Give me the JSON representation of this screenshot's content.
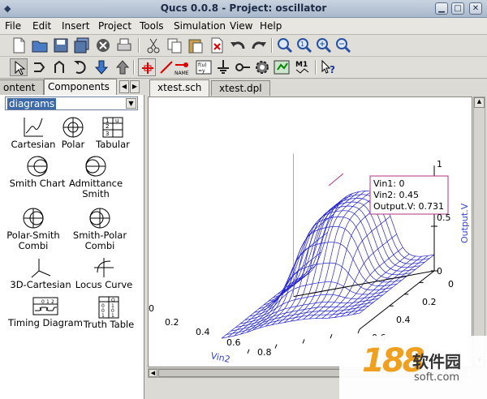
{
  "window": {
    "title": "Qucs 0.0.8 - Project: oscillator"
  },
  "menu": [
    "File",
    "Edit",
    "Insert",
    "Project",
    "Tools",
    "Simulation",
    "View",
    "Help"
  ],
  "left_panel": {
    "tabs": [
      "ontent",
      "Components"
    ],
    "category": "diagrams",
    "components": [
      {
        "label": "Cartesian",
        "icon": "cartesian-icon"
      },
      {
        "label": "Polar",
        "icon": "polar-icon"
      },
      {
        "label": "Tabular",
        "icon": "tabular-icon"
      },
      {
        "label": "Smith Chart",
        "icon": "smith-chart-icon"
      },
      {
        "label": "Admittance Smith",
        "icon": "admittance-smith-icon"
      },
      {
        "label": "Polar-Smith Combi",
        "icon": "polar-smith-icon"
      },
      {
        "label": "Smith-Polar Combi",
        "icon": "smith-polar-icon"
      },
      {
        "label": "3D-Cartesian",
        "icon": "3d-cartesian-icon"
      },
      {
        "label": "Locus Curve",
        "icon": "locus-curve-icon"
      },
      {
        "label": "Timing Diagram",
        "icon": "timing-diagram-icon"
      },
      {
        "label": "Truth Table",
        "icon": "truth-table-icon"
      }
    ],
    "tabular_icon_text": [
      "1",
      "u",
      "2",
      "3"
    ],
    "timing_icon_text": [
      "0",
      "1",
      "2"
    ],
    "truth_icon_text": [
      "Q",
      "0",
      "1",
      "0",
      "0",
      "1",
      "1"
    ]
  },
  "documents": {
    "tabs": [
      "xtest.sch",
      "xtest.dpl"
    ],
    "active": 0
  },
  "plot": {
    "vin1_ticks": [
      "0",
      "0.2",
      "0.4",
      "0.6"
    ],
    "vin2_ticks": [
      "0",
      "0.2",
      "0.4",
      "0.6",
      "0.8"
    ],
    "vin2_label": "Vin2",
    "output_ticks": [
      "0",
      "0.5",
      "1"
    ],
    "output_label": "Output.V",
    "tooltip": [
      "Vin1: 0",
      "Vin2: 0.45",
      "Output.V: 0.731"
    ],
    "colors": {
      "mesh": "#2222cc",
      "axis": "#000000",
      "label": "#3344cc",
      "marker": "#b03080"
    }
  },
  "watermark": {
    "number": "188",
    "brand": "软件园",
    "url": "soft.com"
  }
}
